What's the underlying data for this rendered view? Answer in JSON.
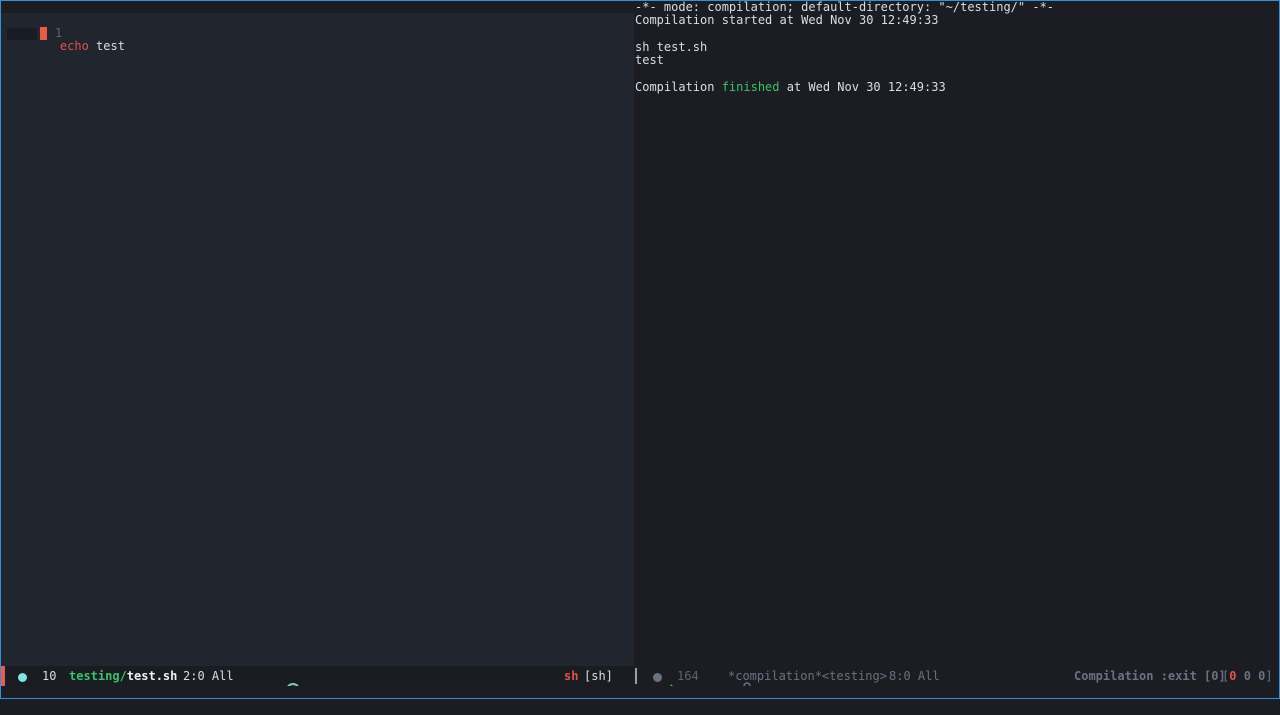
{
  "editor": {
    "lines": [
      {
        "number": "1",
        "keyword": "echo",
        "rest": " test"
      }
    ]
  },
  "compilation": {
    "header": "-*- mode: compilation; default-directory: \"~/testing/\" -*-",
    "started": "Compilation started at Wed Nov 30 12:49:33",
    "command": "sh test.sh",
    "output": "test",
    "finished_prefix": "Compilation ",
    "finished_word": "finished",
    "finished_suffix": " at Wed Nov 30 12:49:33"
  },
  "modeline_left": {
    "line_count": "10",
    "dir": "testing/",
    "file": "test.sh",
    "position": "2:0 All",
    "mode": "sh",
    "mode_bracket": "[sh]",
    "check_icon": "checkmark-icon",
    "mascot_icon": "mascot-icon"
  },
  "modeline_right": {
    "line_count": "164",
    "buffer": "*compilation*<testing>",
    "position": "8:0 All",
    "status": "Compilation :exit [0]",
    "counts_open": "[",
    "count_error": "0",
    "count_warn": "0",
    "count_info": "0",
    "counts_close": "]",
    "lock_icon": "lock-icon"
  },
  "colors": {
    "accent_red": "#e0524a",
    "accent_green": "#3fc06a",
    "dot_cyan": "#7fe3e8",
    "frame_blue": "#3a8fd4"
  }
}
